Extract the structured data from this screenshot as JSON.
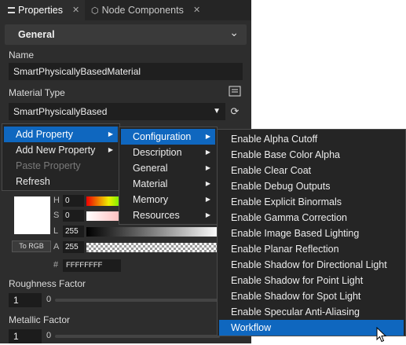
{
  "tabs": {
    "properties": {
      "label": "Properties",
      "close": "✕",
      "icon": "list-icon"
    },
    "node_components": {
      "label": "Node Components",
      "close": "✕",
      "icon": "component-icon"
    }
  },
  "section": {
    "title": "General",
    "icon": "chevron-down-icon"
  },
  "name": {
    "label": "Name",
    "value": "SmartPhysicallyBasedMaterial"
  },
  "material_type": {
    "label": "Material Type",
    "value": "SmartPhysicallyBased",
    "icon": "dropdown-arrow-icon",
    "buttons": [
      "edit-icon",
      "refresh-icon"
    ]
  },
  "color": {
    "to_rgb": "To RGB",
    "h_label": "H",
    "h": "0",
    "s_label": "S",
    "s": "0",
    "l_label": "L",
    "l": "255",
    "a_label": "A",
    "a": "255",
    "hash": "#",
    "hex": "FFFFFFFF",
    "swatch_color": "#ffffff"
  },
  "roughness": {
    "label": "Roughness Factor",
    "value": "1",
    "min": "0"
  },
  "metallic": {
    "label": "Metallic Factor",
    "value": "1",
    "min": "0"
  },
  "context_menu": {
    "items": [
      {
        "label": "Add Property",
        "submenu": true,
        "highlighted": true
      },
      {
        "label": "Add New Property",
        "submenu": true
      },
      {
        "label": "Paste Property",
        "disabled": true
      },
      {
        "label": "Refresh"
      }
    ]
  },
  "property_menu": {
    "items": [
      {
        "label": "Configuration",
        "submenu": true,
        "highlighted": true
      },
      {
        "label": "Description",
        "submenu": true
      },
      {
        "label": "General",
        "submenu": true
      },
      {
        "label": "Material",
        "submenu": true
      },
      {
        "label": "Memory",
        "submenu": true
      },
      {
        "label": "Resources",
        "submenu": true
      }
    ]
  },
  "config_menu": {
    "items": [
      {
        "label": "Enable Alpha Cutoff"
      },
      {
        "label": "Enable Base Color Alpha"
      },
      {
        "label": "Enable Clear Coat"
      },
      {
        "label": "Enable Debug Outputs"
      },
      {
        "label": "Enable Explicit Binormals"
      },
      {
        "label": "Enable Gamma Correction"
      },
      {
        "label": "Enable Image Based Lighting"
      },
      {
        "label": "Enable Planar Reflection"
      },
      {
        "label": "Enable Shadow for Directional Light"
      },
      {
        "label": "Enable Shadow for Point Light"
      },
      {
        "label": "Enable Shadow for Spot Light"
      },
      {
        "label": "Enable Specular Anti-Aliasing"
      },
      {
        "label": "Workflow",
        "highlighted": true
      }
    ]
  },
  "colors": {
    "highlight": "#0f67bf",
    "panel": "#2d2d2d",
    "menu": "#252525"
  }
}
